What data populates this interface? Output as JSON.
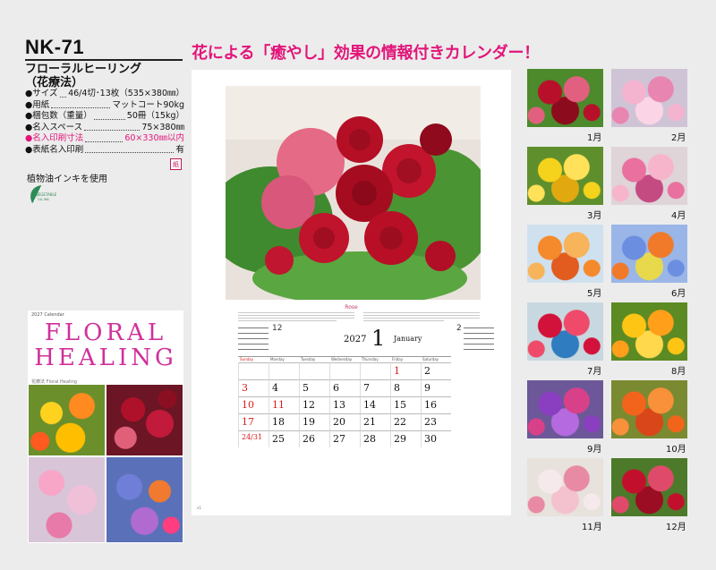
{
  "product": {
    "code": "NK-71",
    "name_line1": "フローラルヒーリング",
    "name_line2": "（花療法）"
  },
  "specs": [
    {
      "label": "●サイズ",
      "value": "46/4切･13枚（535×380㎜）",
      "pink": false
    },
    {
      "label": "●用紙",
      "value": "マットコート90kg",
      "pink": false
    },
    {
      "label": "●梱包数（重量）",
      "value": "50冊（15kg）",
      "pink": false
    },
    {
      "label": "●名入スペース",
      "value": "75×380㎜",
      "pink": false
    },
    {
      "label": "●名入印刷寸法",
      "value": "60×330㎜以内",
      "pink": true
    },
    {
      "label": "●表紙名入印刷",
      "value": "有",
      "pink": false
    }
  ],
  "eco_icon_text": "紙",
  "ink_note": "植物油インキを使用",
  "veg_logo_text": "VEGETABLE OIL INK",
  "headline": "花による「癒やし」効果の情報付きカレンダー！",
  "cover": {
    "header": "2027 Calendar",
    "title_line1": "FLORAL",
    "title_line2": "HEALING",
    "subtitle": "花療法 Floral Healing"
  },
  "calendar": {
    "flower_title": "Rose",
    "year": "2027",
    "month_number": "1",
    "month_name": "January",
    "weekdays": [
      "Sunday",
      "Monday",
      "Tuesday",
      "Wednesday",
      "Thursday",
      "Friday",
      "Saturday"
    ],
    "prev_month": "12",
    "next_month": "2",
    "page_number": "x1",
    "weeks": [
      [
        "",
        "",
        "",
        "",
        "",
        "1",
        "2"
      ],
      [
        "3",
        "4",
        "5",
        "6",
        "7",
        "8",
        "9"
      ],
      [
        "10",
        "11",
        "12",
        "13",
        "14",
        "15",
        "16"
      ],
      [
        "17",
        "18",
        "19",
        "20",
        "21",
        "22",
        "23"
      ],
      [
        "24/31",
        "25",
        "26",
        "27",
        "28",
        "29",
        "30"
      ]
    ],
    "red_days": [
      "1",
      "3",
      "10",
      "11",
      "17",
      "24/31"
    ]
  },
  "months": [
    {
      "label": "1月",
      "image": "red-pink-roses"
    },
    {
      "label": "2月",
      "image": "pink-bouquet"
    },
    {
      "label": "3月",
      "image": "yellow-flowers-basket"
    },
    {
      "label": "4月",
      "image": "pink-dahlias"
    },
    {
      "label": "5月",
      "image": "orange-lilies"
    },
    {
      "label": "6月",
      "image": "blue-hydrangea-mix"
    },
    {
      "label": "7月",
      "image": "red-flowers-vases"
    },
    {
      "label": "8月",
      "image": "sunflowers"
    },
    {
      "label": "9月",
      "image": "purple-dahlias"
    },
    {
      "label": "10月",
      "image": "orange-roses-wreath"
    },
    {
      "label": "11月",
      "image": "white-pink-tea"
    },
    {
      "label": "12月",
      "image": "red-roses-basket"
    }
  ],
  "colors": {
    "accent": "#e2167a",
    "sunday": "#d81c1c"
  }
}
